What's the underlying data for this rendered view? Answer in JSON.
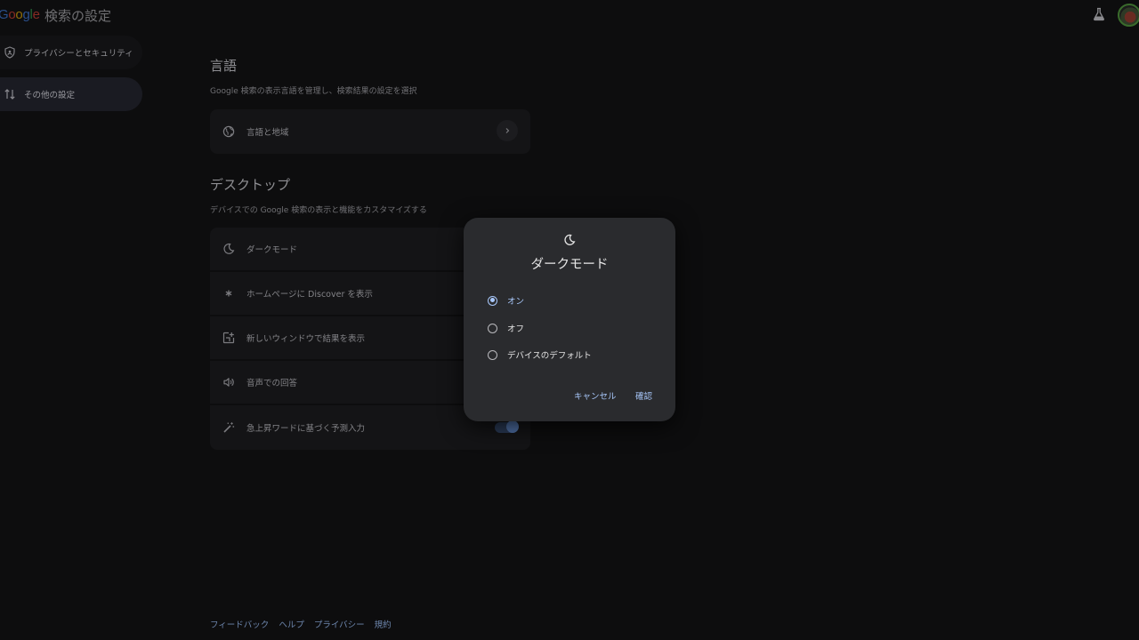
{
  "header": {
    "logo_letters": [
      "G",
      "o",
      "o",
      "g",
      "l",
      "e"
    ],
    "logo_colors": [
      "#4285f4",
      "#ea4335",
      "#fbbc05",
      "#4285f4",
      "#34a853",
      "#ea4335"
    ],
    "title": "検索の設定"
  },
  "sidebar": {
    "items": [
      {
        "label": "プライバシーとセキュリティ",
        "icon": "shield-icon"
      },
      {
        "label": "その他の設定",
        "icon": "swap-vert-icon",
        "active": true
      }
    ]
  },
  "sections": {
    "language": {
      "title": "言語",
      "desc": "Google 検索の表示言語を管理し、検索結果の設定を選択",
      "rows": [
        {
          "label": "言語と地域",
          "icon": "globe-icon"
        }
      ]
    },
    "desktop": {
      "title": "デスクトップ",
      "desc": "デバイスでの Google 検索の表示と機能をカスタマイズする",
      "rows": [
        {
          "label": "ダークモード",
          "icon": "moon-icon"
        },
        {
          "label": "ホームページに Discover を表示",
          "icon": "asterisk-icon"
        },
        {
          "label": "新しいウィンドウで結果を表示",
          "icon": "new-window-icon"
        },
        {
          "label": "音声での回答",
          "icon": "speaker-icon"
        },
        {
          "label": "急上昇ワードに基づく予測入力",
          "icon": "magic-wand-icon",
          "toggle_on": true
        }
      ]
    }
  },
  "footer": {
    "links": [
      "フィードバック",
      "ヘルプ",
      "プライバシー",
      "規約"
    ]
  },
  "dialog": {
    "title": "ダークモード",
    "options": [
      {
        "label": "オン",
        "selected": true
      },
      {
        "label": "オフ",
        "selected": false
      },
      {
        "label": "デバイスのデフォルト",
        "selected": false
      }
    ],
    "cancel_label": "キャンセル",
    "confirm_label": "確認"
  },
  "colors": {
    "accent": "#a8c7fa",
    "background": "#0d0d0e",
    "dialog_bg": "#2a2b2e"
  }
}
